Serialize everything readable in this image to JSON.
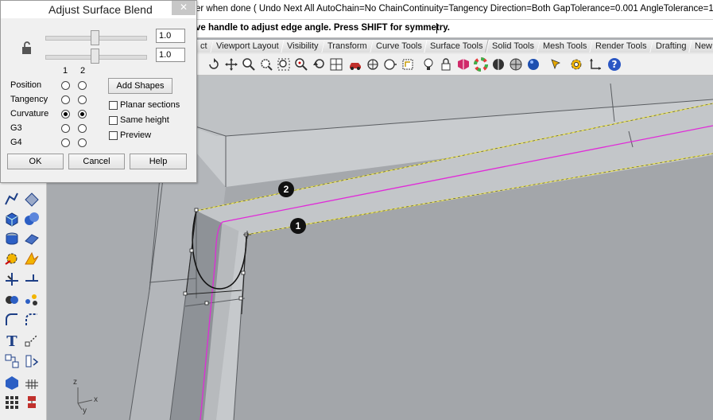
{
  "command_line": {
    "history": "er when done ( Undo  Next  All  AutoChain=No  ChainContinuity=Tangency  Direction=Both  GapTolerance=0.001  AngleTolerance=1",
    "prompt": "ve handle to adjust edge angle. Press SHIFT for symmetry."
  },
  "tabs": [
    "ct",
    "Viewport Layout",
    "Visibility",
    "Transform",
    "Curve Tools",
    "Surface Tools",
    "Solid Tools",
    "Mesh Tools",
    "Render Tools",
    "Drafting",
    "New i"
  ],
  "toolbar_icons": [
    "rotate-view-icon",
    "pan-icon",
    "zoom-icon",
    "zoom-window-icon",
    "zoom-extents-icon",
    "zoom-selected-icon",
    "undo-view-icon",
    "four-viewports-icon",
    "car-icon",
    "camera-target-icon",
    "named-view-icon",
    "named-cplane-icon",
    "light-icon",
    "lock-icon",
    "shaded-icon",
    "color-wheel-icon",
    "render-sphere-icon",
    "ghosted-icon",
    "rendered-sphere-icon",
    "select-filter-icon",
    "options-gear-icon",
    "cplane-icon",
    "help-icon"
  ],
  "sidebar_icons": [
    "curve-tools-icon",
    "surface-tools-icon",
    "solid-box-icon",
    "solid-union-icon",
    "extrude-icon",
    "surface-from-curves-icon",
    "explode-icon",
    "split-icon",
    "trim-icon",
    "extend-icon",
    "boolean-icon",
    "point-cloud-icon",
    "fillet-icon",
    "blend-curve-icon",
    "text-icon",
    "dimension-icon",
    "grid-snap-icon",
    "analysis-icon",
    "render-icon",
    "mesh-icon",
    "array-icon",
    "transform-icon"
  ],
  "dialog": {
    "title": "Adjust Surface Blend",
    "close_label": "✕",
    "value1": "1.0",
    "value2": "1.0",
    "col1": "1",
    "col2": "2",
    "rows": [
      "Position",
      "Tangency",
      "Curvature",
      "G3",
      "G4"
    ],
    "selected_row": "Curvature",
    "add_shapes": "Add Shapes",
    "planar_sections": "Planar sections",
    "same_height": "Same height",
    "preview": "Preview",
    "ok": "OK",
    "cancel": "Cancel",
    "help": "Help"
  },
  "viewport": {
    "callout1": "1",
    "callout2": "2",
    "axis_x": "x",
    "axis_y": "y",
    "axis_z": "z"
  },
  "colors": {
    "edge_highlight": "#e8e04c",
    "blend_curve": "#e02ad8",
    "surface_dark": "#8f9398",
    "surface_light": "#b9bcbf"
  }
}
